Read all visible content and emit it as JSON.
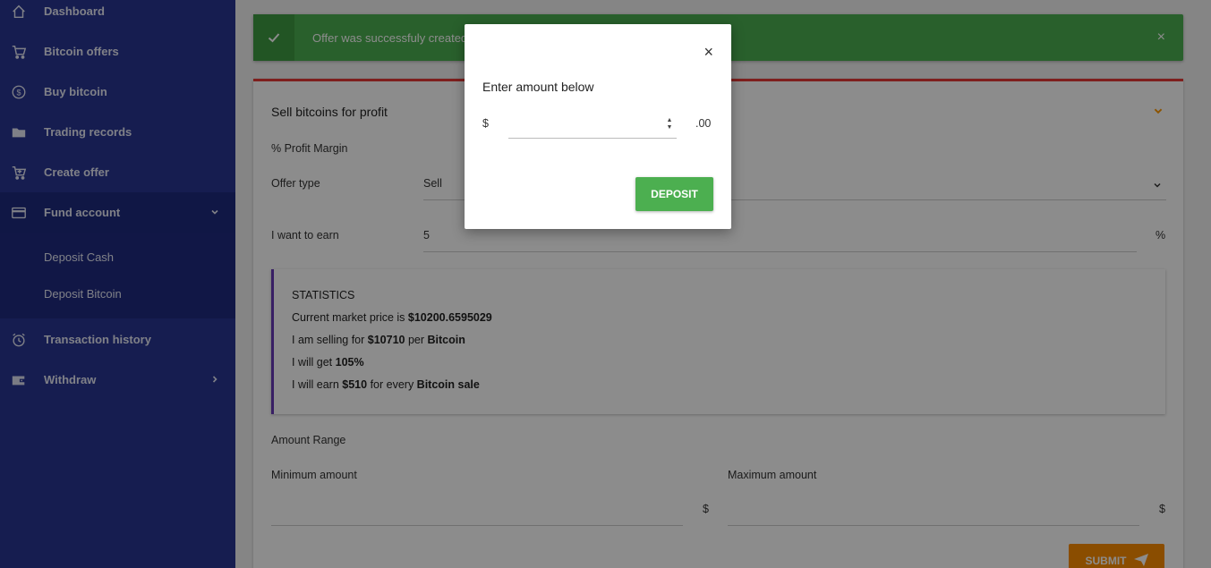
{
  "sidebar": {
    "items": [
      {
        "label": "Dashboard",
        "icon": "home-icon"
      },
      {
        "label": "Bitcoin offers",
        "icon": "cart-icon"
      },
      {
        "label": "Buy bitcoin",
        "icon": "dollar-coin-icon"
      },
      {
        "label": "Trading records",
        "icon": "folder-icon"
      },
      {
        "label": "Create offer",
        "icon": "cart-plus-icon"
      },
      {
        "label": "Fund account",
        "icon": "credit-card-icon",
        "expanded": true
      },
      {
        "label": "Transaction history",
        "icon": "alarm-clock-icon"
      },
      {
        "label": "Withdraw",
        "icon": "wallet-icon"
      }
    ],
    "fund_submenu": [
      "Deposit Cash",
      "Deposit Bitcoin"
    ]
  },
  "alert": {
    "message": "Offer was successfuly created",
    "close": "×"
  },
  "card": {
    "title": "Sell bitcoins for profit",
    "profit_margin_label": "% Profit Margin",
    "offer_type_label": "Offer type",
    "offer_type_value": "Sell",
    "earn_label": "I want to earn",
    "earn_value": "5",
    "earn_unit": "%",
    "stats": {
      "heading": "STATISTICS",
      "line1_prefix": "Current market price is ",
      "line1_value": "$10200.6595029",
      "line2_prefix": "I am selling for ",
      "line2_value": "$10710",
      "line2_mid": " per ",
      "line2_suffix": "Bitcoin",
      "line3_prefix": "I will get ",
      "line3_value": "105%",
      "line4_prefix": "I will earn ",
      "line4_value": "$510",
      "line4_mid": " for every ",
      "line4_suffix": "Bitcoin sale"
    },
    "amount_range_label": "Amount Range",
    "min_label": "Minimum amount",
    "max_label": "Maximum amount",
    "currency": "$",
    "submit_label": "SUBMIT"
  },
  "modal": {
    "close": "×",
    "title": "Enter amount below",
    "currency": "$",
    "cents": ".00",
    "amount_value": "",
    "deposit_label": "DEPOSIT"
  },
  "colors": {
    "sidebar": "#283593",
    "success": "#4caf50",
    "accent_orange": "#fb8c00",
    "card_top_border": "#e53935",
    "stats_border": "#673ab7"
  }
}
